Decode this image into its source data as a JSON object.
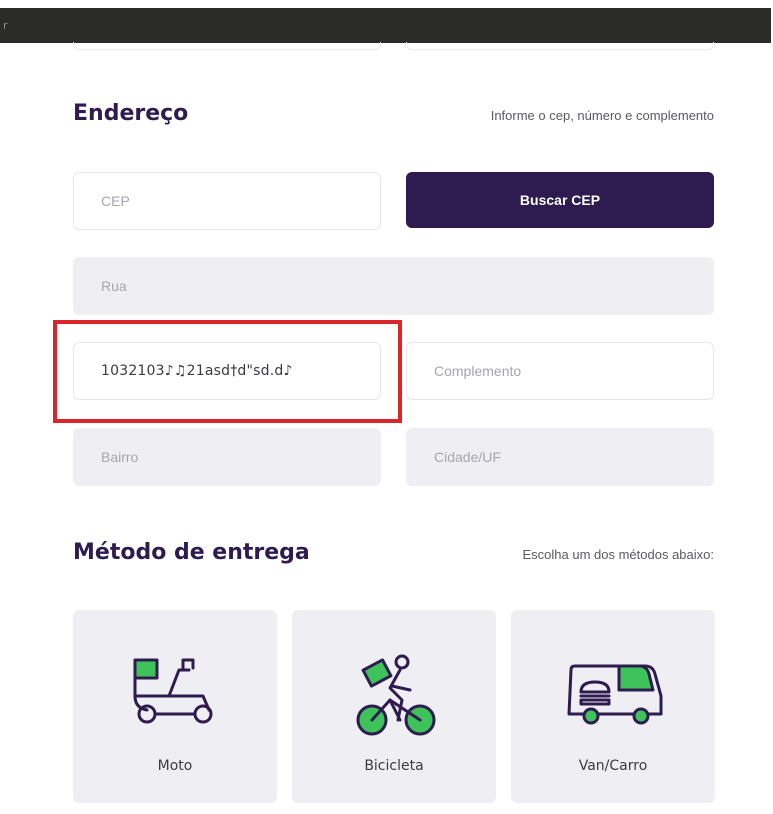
{
  "topbar": {
    "edge_char": "r"
  },
  "address": {
    "title": "Endereço",
    "hint": "Informe o cep, número e complemento",
    "cep_placeholder": "CEP",
    "buscar_label": "Buscar CEP",
    "rua_placeholder": "Rua",
    "numero_value": "1032103♪♫21asd†d\"sd.d♪",
    "complemento_placeholder": "Complemento",
    "bairro_placeholder": "Bairro",
    "cidade_placeholder": "Cidade/UF"
  },
  "delivery": {
    "title": "Método de entrega",
    "hint": "Escolha um dos métodos abaixo:",
    "methods": [
      {
        "label": "Moto",
        "icon": "scooter-icon"
      },
      {
        "label": "Bicicleta",
        "icon": "bicycle-courier-icon"
      },
      {
        "label": "Van/Carro",
        "icon": "delivery-van-icon"
      }
    ]
  },
  "colors": {
    "primary": "#2E1B4F",
    "accent_green": "#3DC35A",
    "field_fill": "#EFEFF3",
    "highlight_red": "#D9262B"
  }
}
